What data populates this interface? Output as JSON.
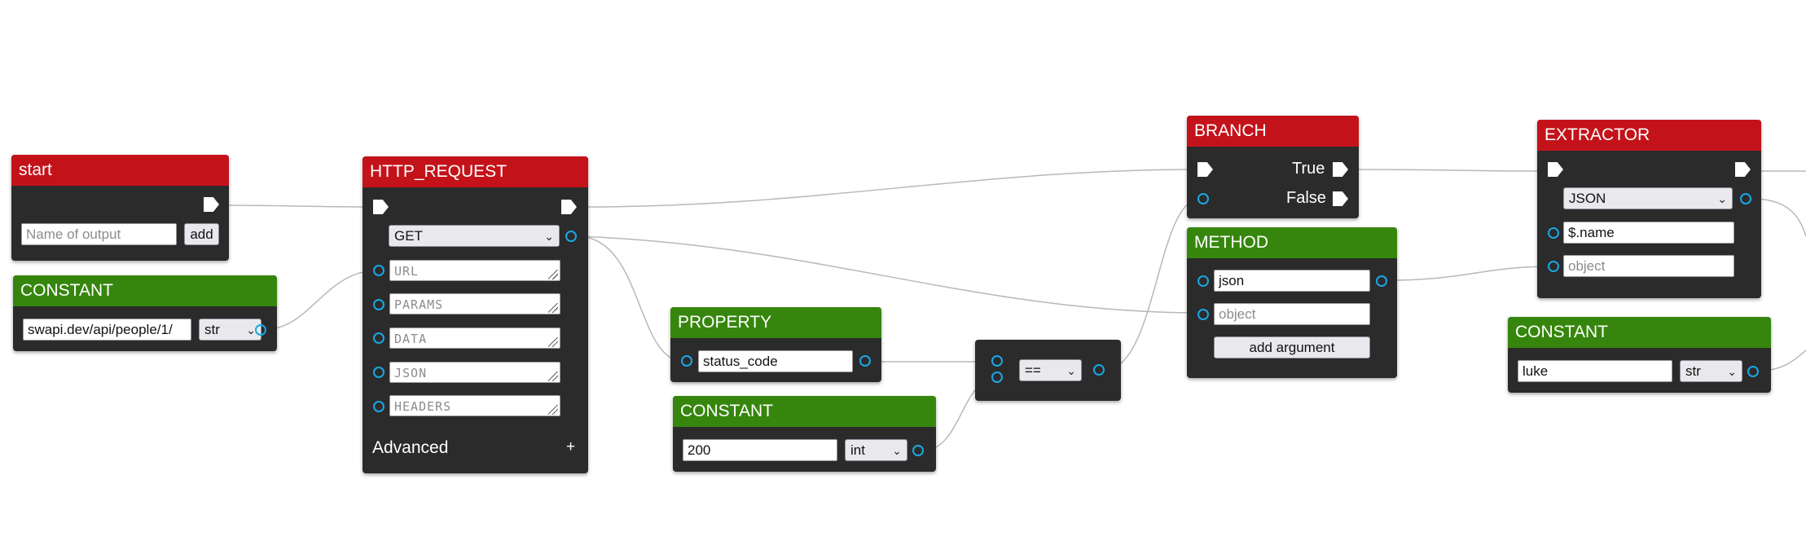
{
  "colors": {
    "flow_header": "#c4121a",
    "value_header": "#36860e",
    "node_body": "#2b2b2b",
    "port": "#1aa7e6",
    "wire": "#b8b8b8"
  },
  "icons": {
    "flow_port": "flow-arrow-icon",
    "data_port": "data-port-icon",
    "select": "chevron-down-icon"
  },
  "start": {
    "title": "start",
    "name_placeholder": "Name of output",
    "add_label": "add"
  },
  "constant_url": {
    "title": "CONSTANT",
    "value": "swapi.dev/api/people/1/",
    "type": "str"
  },
  "http_request": {
    "title": "HTTP_REQUEST",
    "method": "GET",
    "url_placeholder": "URL",
    "params_placeholder": "PARAMS",
    "data_placeholder": "DATA",
    "json_placeholder": "JSON",
    "headers_placeholder": "HEADERS",
    "advanced_label": "Advanced",
    "advanced_toggle": "+"
  },
  "property": {
    "title": "PROPERTY",
    "value": "status_code"
  },
  "constant_code": {
    "title": "CONSTANT",
    "value": "200",
    "type": "int"
  },
  "compare": {
    "operator": "=="
  },
  "branch": {
    "title": "BRANCH",
    "true_label": "True",
    "false_label": "False"
  },
  "method": {
    "title": "METHOD",
    "name": "json",
    "object_placeholder": "object",
    "add_argument_label": "add argument"
  },
  "extractor": {
    "title": "EXTRACTOR",
    "format": "JSON",
    "path": "$.name",
    "object_placeholder": "object"
  },
  "constant_luke": {
    "title": "CONSTANT",
    "value": "luke",
    "type": "str"
  }
}
